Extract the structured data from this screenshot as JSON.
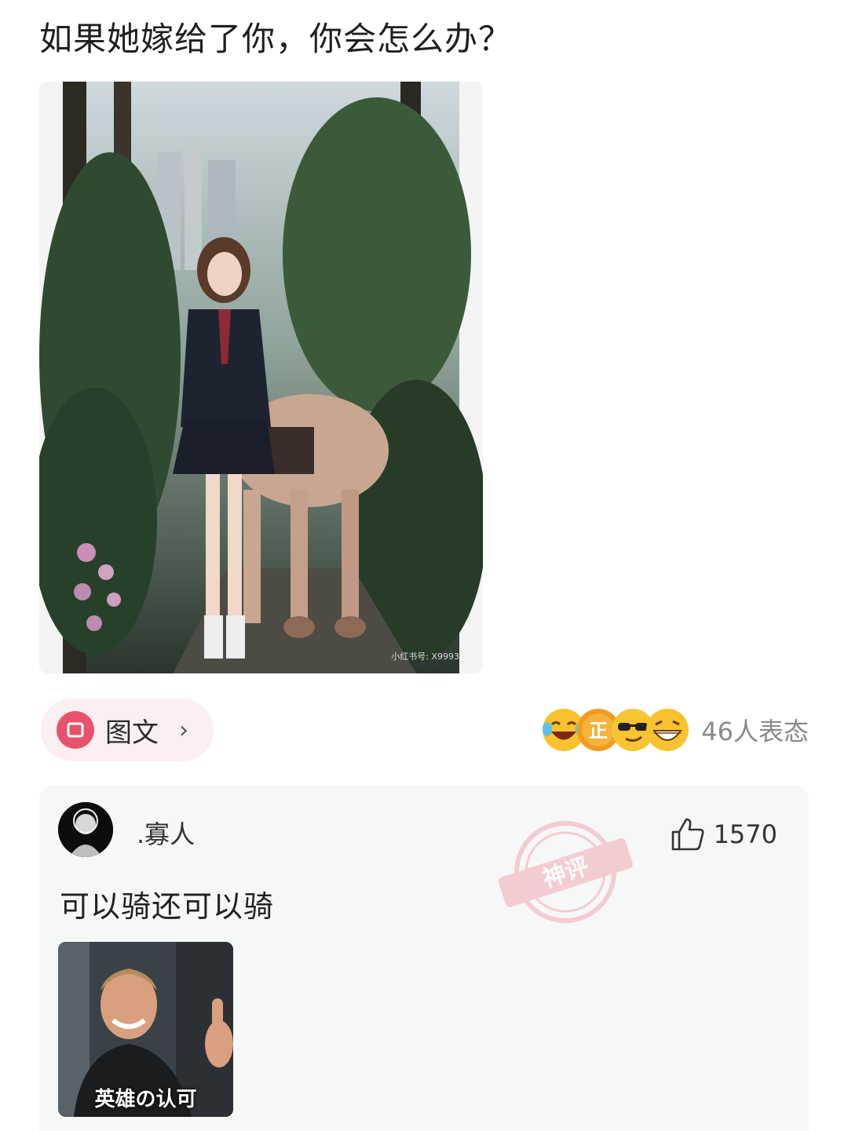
{
  "post": {
    "title": "如果她嫁给了你，你会怎么办？",
    "image_watermark": "小红书号: X9993"
  },
  "category": {
    "label": "图文",
    "chevron": "›",
    "icon": "rounded-square-icon",
    "accent": "#e8526b"
  },
  "reactions": {
    "emojis": [
      "laughing-tears-emoji",
      "zheng-badge-emoji",
      "sunglasses-emoji",
      "grinning-emoji"
    ],
    "count_text": "46人表态"
  },
  "comment": {
    "username": ".寡人",
    "like_count": "1570",
    "text": "可以骑还可以骑",
    "meme_caption": "英雄の认可",
    "stamp_text": "神评"
  }
}
